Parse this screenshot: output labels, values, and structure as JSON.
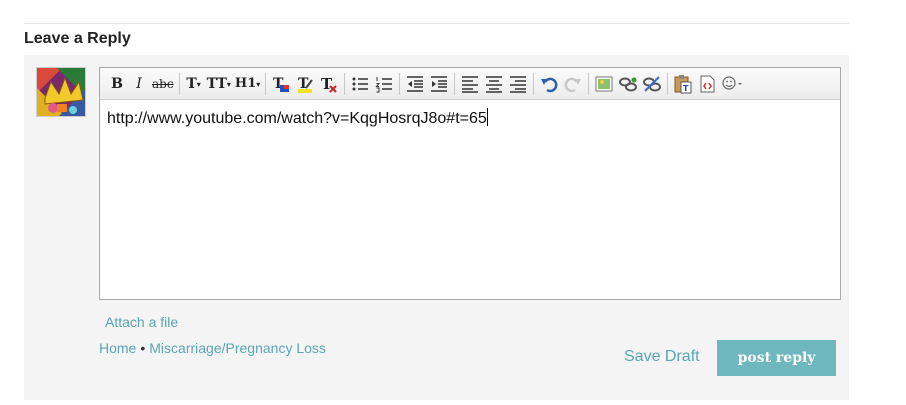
{
  "section": {
    "title": "Leave a Reply"
  },
  "toolbar": {
    "bold": "B",
    "italic": "I",
    "strike": "abc",
    "font_size": "T",
    "font_family": "TT",
    "heading": "H1",
    "items": [
      "bold",
      "italic",
      "strikethrough",
      "font-size",
      "font-family",
      "heading",
      "text-color",
      "highlight",
      "remove-format",
      "bullet-list",
      "numbered-list",
      "outdent",
      "indent",
      "align-left",
      "align-center",
      "align-right",
      "undo",
      "redo",
      "image",
      "link",
      "unlink",
      "paste-word",
      "html-source",
      "emoji"
    ]
  },
  "editor": {
    "content": "http://www.youtube.com/watch?v=KqgHosrqJ8o#t=65"
  },
  "links": {
    "attach": "Attach a file",
    "home": "Home",
    "separator": "•",
    "forum": "Miscarriage/Pregnancy Loss"
  },
  "actions": {
    "save_draft": "Save Draft",
    "post_reply": "post reply"
  },
  "colors": {
    "accent": "#6fb7bf",
    "link": "#5aa5b0",
    "panel": "#f4f4f4"
  }
}
